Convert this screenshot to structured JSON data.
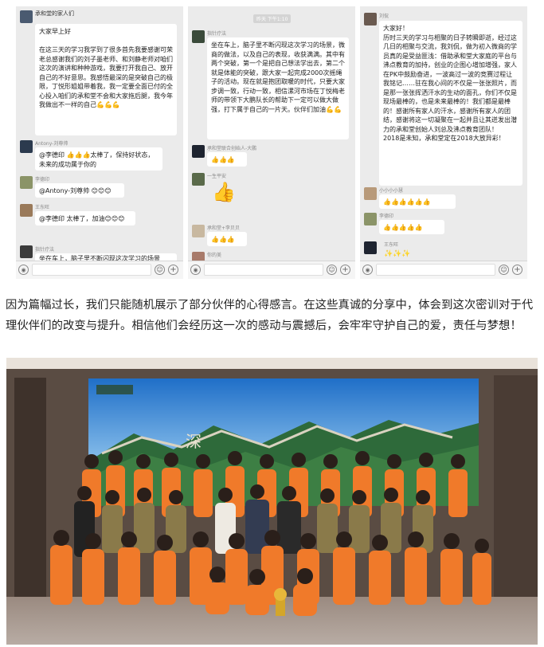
{
  "screenshots": [
    {
      "timestamp": "",
      "messages": [
        {
          "nick": "承和堂的家人们",
          "text": "大家早上好\n\n在这三天的学习我学到了很多首先我要感谢可荣老总感谢我们的刘子墨老师、和刘静老师对咱们这次的演讲和种种游戏，我要打开我自己、放开自己的不好意思。我感悟最深的是突破自己的极限，丁悦形姐姐带着我，我一定要全面已付的全心投入咱们的承和堂不会和大家拖后腿，我今年我做出不一样的自己💪💪💪"
        },
        {
          "nick": "Antony-刘尊帅",
          "text": "@李德印 👍👍👍太棒了，保持好状态，未来的成功属于你的"
        },
        {
          "nick": "李德印",
          "text": "@Antony-刘尊帅 😊😊😊"
        },
        {
          "nick": "王东旺",
          "text": "@李德印 太棒了，加油😊😊😊"
        },
        {
          "nick": "指针疗法",
          "text": "坐在车上，脑子里不断闪现这次学习的场景"
        }
      ]
    },
    {
      "timestamp": "昨天 下午1:10",
      "messages": [
        {
          "nick": "指针疗法",
          "text": "坐在车上，脑子里不断闪现这次学习的场景，微商的做法，以及自己的表现，收获满满。其中有两个突破，第一个是把自己想法学出去，第二个就是体能的突破，跟大家一起完成2000次摇绳子的活动。现在就是抱团取暖的时代，只要大家步调一致，行动一致，相信漯河市场在丁悦梅老师的带领下大鹏队长的帮助下一定可以做大做强，打下属于自己的一片天。伙伴们加油💪💪"
        },
        {
          "nick": "承和堂联合创始人-大鹏",
          "text": "👍👍👍"
        },
        {
          "nick": "一生平安",
          "text": "👍"
        },
        {
          "nick": "承和堂+李贝贝",
          "text": "👍👍👍"
        },
        {
          "nick": "你的美",
          "text": ""
        }
      ]
    },
    {
      "timestamp": "",
      "messages": [
        {
          "nick": "刘侃",
          "text": "大家好！\n历时三天的学习与相聚的日子转瞬即逝，经过这几日的相聚与交流，我刘侃，做为初入微商的学员真的是受益匪浅：借助承和堂大家庭的平台与沸点教育的加持，创业的企图心增加增强，家人在PK中鼓励奋进，一波高过一波的竞赛过程让我铭记……驻在我心间的不仅是一张张照片，而是那一张张挥洒汗水的生动的面孔，你们不仅是现场最棒的，也是未来最棒的！我们都是最棒的！感谢所有家人的汗水，感谢所有家人的团结，感谢将这一切凝聚在一起并且让其迸发出潜力的承和堂创始人刘总及沸点教育团队！\n2018是未知，承和堂定在2018大放异彩！"
        },
        {
          "nick": "小小小小慧",
          "text": "👍👍👍👍👍👍"
        },
        {
          "nick": "李德印",
          "text": "👍👍👍👍👍"
        },
        {
          "nick": "王东旺",
          "text": "✨✨✨"
        }
      ]
    }
  ],
  "caption": "因为篇幅过长，我们只能随机展示了部分伙伴的心得感言。在这些真诚的分享中，体会到这次密训对于代理伙伴们的改变与提升。相信他们会经历这一次的感动与震撼后，会牢牢守护自己的爱，责任与梦想！",
  "photo_screen_text": "深",
  "colors": {
    "vest": "#f07a2a",
    "screen_sky": "#2a7fd4",
    "wall": "#5a4c43",
    "chat_bg": "#ebebeb"
  }
}
